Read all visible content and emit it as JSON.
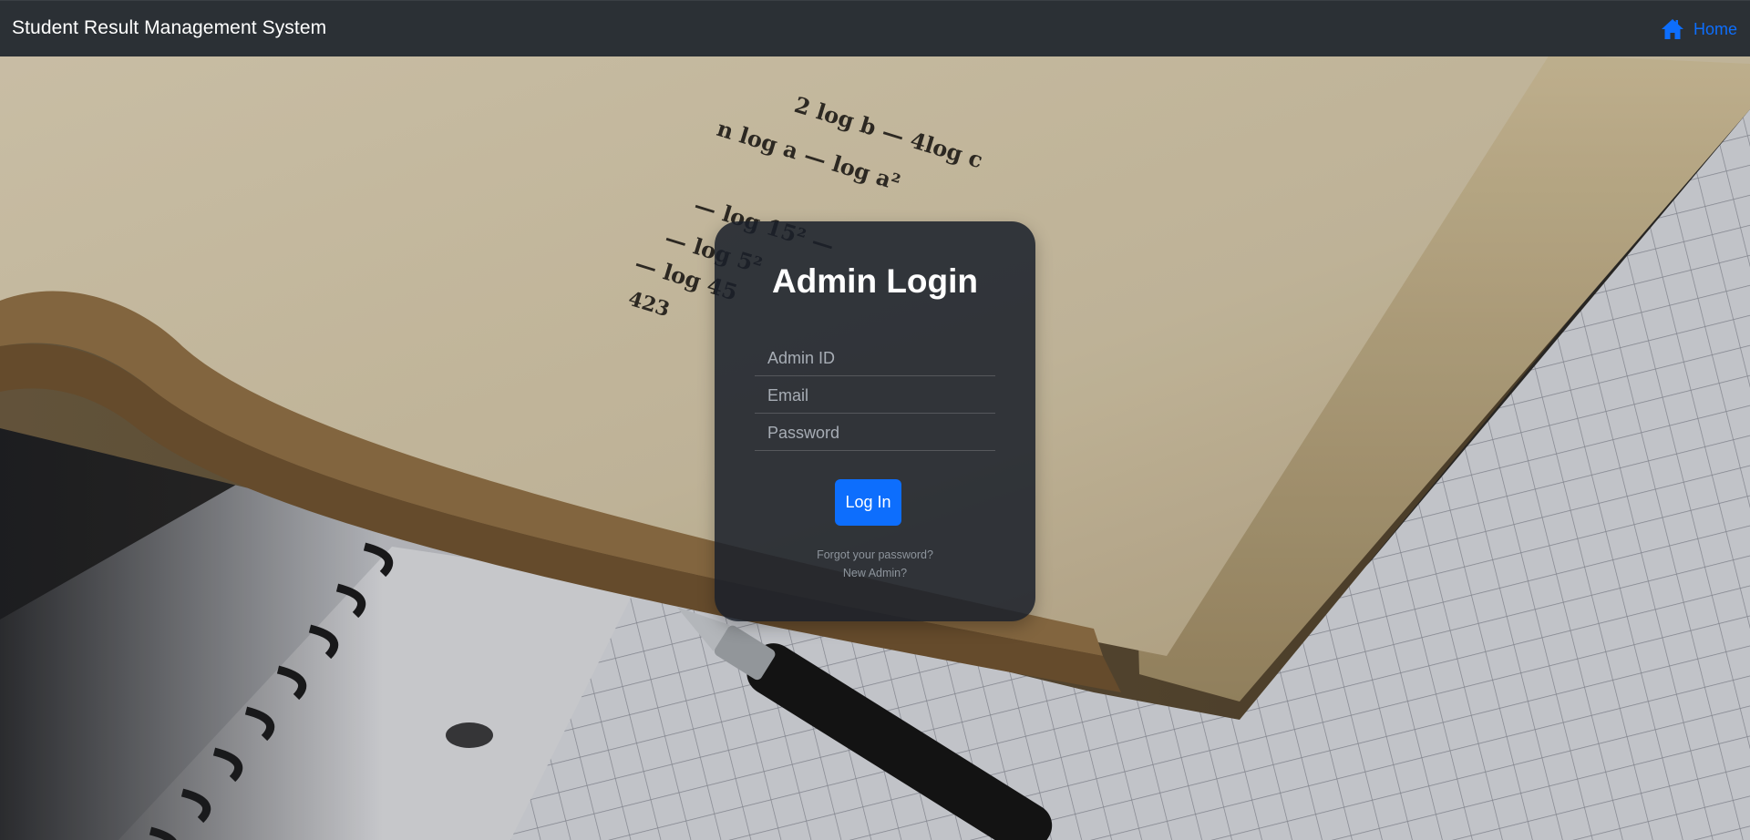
{
  "navbar": {
    "brand": "Student Result Management System",
    "home_label": "Home",
    "home_icon": "house-icon",
    "home_color": "#0d6efd",
    "background": "#2b3035"
  },
  "login": {
    "title": "Admin Login",
    "fields": {
      "admin_id": {
        "placeholder": "Admin ID",
        "value": ""
      },
      "email": {
        "placeholder": "Email",
        "value": ""
      },
      "password": {
        "placeholder": "Password",
        "value": ""
      }
    },
    "submit_label": "Log In",
    "submit_color": "#0d6efd",
    "forgot_password": "Forgot your password?",
    "new_admin": "New Admin?"
  },
  "background": {
    "book_text": [
      "2 log b — 4log c",
      "n log a — log a²",
      "— log 15² —",
      "— log 5²",
      "— log 45",
      "423"
    ]
  }
}
